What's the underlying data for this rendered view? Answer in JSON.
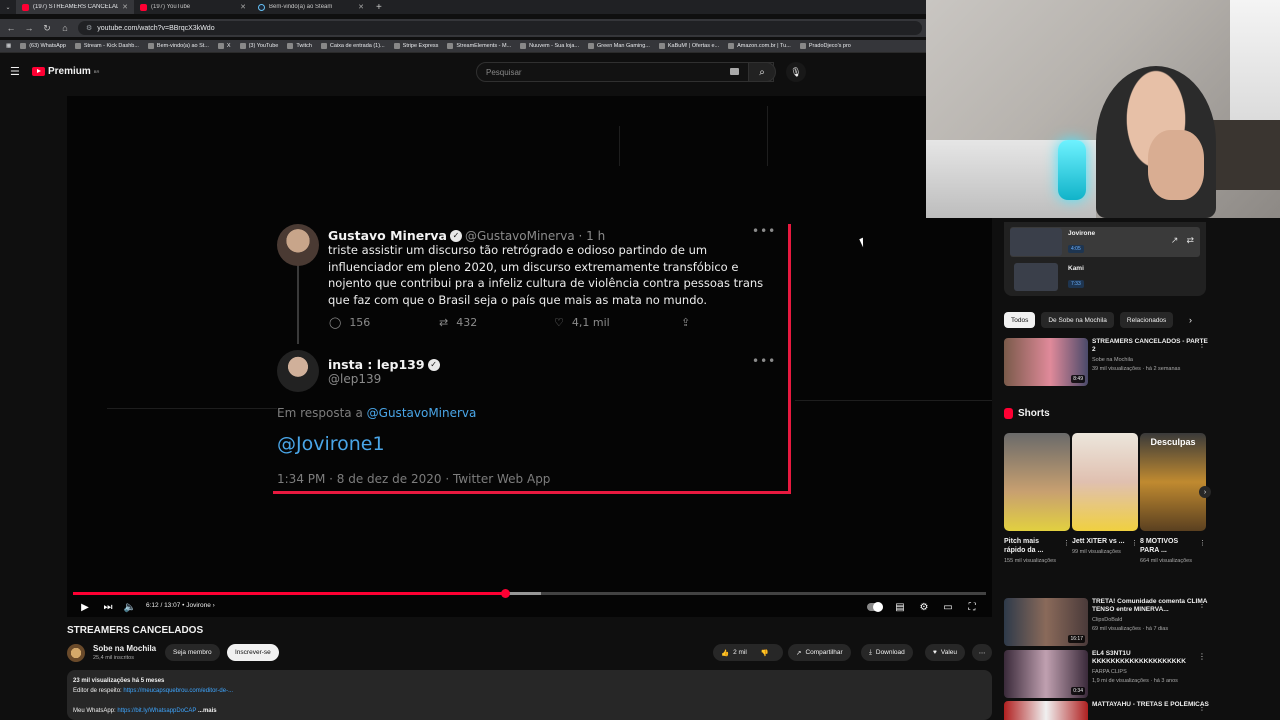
{
  "browser": {
    "tabs": [
      {
        "label": "(197) STREAMERS CANCELADOS",
        "active": true,
        "favicon": "youtube-icon"
      },
      {
        "label": "(197) YouTube",
        "active": false,
        "favicon": "youtube-icon"
      },
      {
        "label": "Bem-vindo(a) ao Steam",
        "active": false,
        "favicon": "steam-icon"
      }
    ],
    "url": "youtube.com/watch?v=BBrqcX3kWdo",
    "bookmarks": [
      "(63) WhatsApp",
      "Stream - Kick Dashb...",
      "Bem-vindo(a) ao St...",
      "X",
      "(3) YouTube",
      "Twitch",
      "Caixa de entrada (1)...",
      "Stripe Express",
      "StreamElements - M...",
      "Nuuvem - Sua loja...",
      "Green Man Gaming...",
      "KaBuM! | Ofertas e...",
      "Amazon.com.br | Tu...",
      "PradoDjeco's pro"
    ]
  },
  "header": {
    "logo_text": "Premium",
    "logo_region": "BR",
    "search_placeholder": "Pesquisar"
  },
  "video": {
    "tweet1": {
      "name": "Gustavo Minerva",
      "handle": "@GustavoMinerva · 1 h",
      "text": "triste assistir um discurso tão retrógrado e odioso partindo de um influenciador em pleno 2020, um discurso extremamente transfóbico e nojento que contribui pra a infeliz cultura de violência contra pessoas trans que faz com que o Brasil seja o país que mais as mata no mundo.",
      "replies": "156",
      "retweets": "432",
      "likes": "4,1 mil"
    },
    "tweet2": {
      "name": "insta : lep139",
      "handle": "@lep139",
      "reply_prefix": "Em resposta a",
      "reply_to": "@GustavoMinerva",
      "mention": "@Jovirone1",
      "date": "1:34 PM · 8 de dez de 2020 · Twitter Web App"
    },
    "time": "6:12 / 13:07",
    "chapter": "Jovirone",
    "progress_played": 0.473,
    "progress_buffered": 0.513
  },
  "title": "STREAMERS CANCELADOS",
  "channel": {
    "name": "Sobe na Mochila",
    "subs": "25,4 mil inscritos",
    "member_label": "Seja membro",
    "subscribe_label": "Inscrever-se"
  },
  "actions": {
    "likes": "2 mil",
    "share": "Compartilhar",
    "download": "Download",
    "thanks": "Valeu"
  },
  "description": {
    "stats": "23 mil visualizações  há 5 meses",
    "editor_label": "Editor de respeito:",
    "editor_link": "https://meucapsquebrou.com/editor-de-...",
    "whatsapp_label": "Meu WhatsApp:",
    "whatsapp_link": "https://bit.ly/WhatsappDoCAP",
    "more": "...mais"
  },
  "playlist": [
    {
      "title": "Jovirone",
      "duration": "4:05"
    },
    {
      "title": "Kami",
      "duration": "7:33"
    }
  ],
  "chips": [
    "Todos",
    "De Sobe na Mochila",
    "Relacionados"
  ],
  "recommended_top": {
    "title": "STREAMERS CANCELADOS - PARTE 2",
    "channel": "Sobe na Mochila",
    "meta": "39 mil visualizações · há 2 semanas",
    "duration": "8:49"
  },
  "shorts": {
    "heading": "Shorts",
    "items": [
      {
        "title": "Pitch mais rápido da ...",
        "views": "155 mil visualizações",
        "thumb_text": "PRA CARALHO"
      },
      {
        "title": "Jett XITER vs ...",
        "views": "99 mil visualizações",
        "thumb_text": "JETT HACKER"
      },
      {
        "title": "8 MOTIVOS PARA ...",
        "views": "664 mil visualizações",
        "thumb_text": "Desculpas"
      }
    ]
  },
  "recommended": [
    {
      "title": "TRETA! Comunidade comenta CLIMA TENSO entre MINERVA...",
      "channel": "ClipsDoBald",
      "meta": "69 mil visualizações · há 7 dias",
      "duration": "16:17"
    },
    {
      "title": "EL4 S3NT1U KKKKKKKKKKKKKKKKKKKK",
      "channel": "FARPA CLIPS",
      "meta": "1,9 mi de visualizações · há 3 anos",
      "duration": "0:34"
    },
    {
      "title": "MATTAYAHU - TRETAS E POLÊMICAS",
      "channel": "",
      "meta": "",
      "duration": ""
    }
  ],
  "colors": {
    "accent": "#ff0033",
    "link": "#3ea6ff",
    "tweet_border": "#e8193f"
  }
}
